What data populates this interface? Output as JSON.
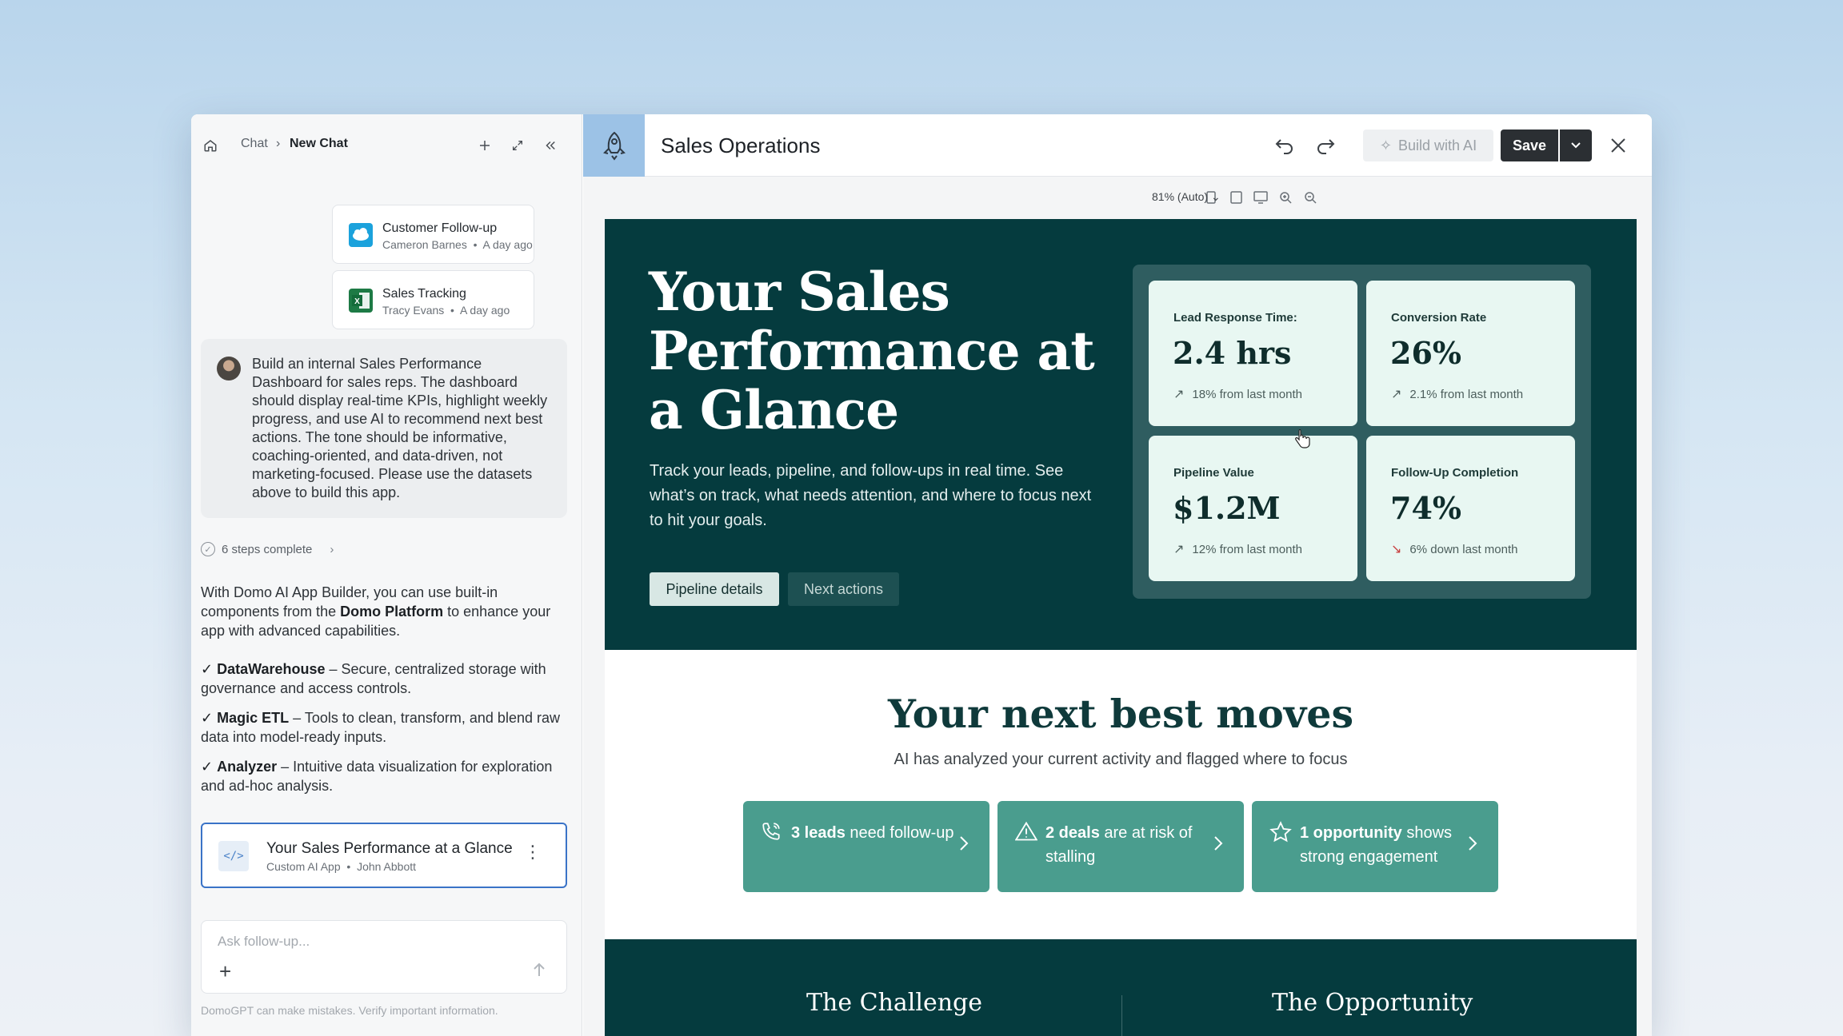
{
  "chat": {
    "breadcrumb": {
      "root": "Chat",
      "separator": "›",
      "current": "New Chat"
    },
    "datasets": [
      {
        "name": "Customer Follow-up",
        "owner": "Cameron Barnes",
        "time": "A day ago",
        "icon": "salesforce-icon",
        "color": "#1ba2dc"
      },
      {
        "name": "Sales Tracking",
        "owner": "Tracy Evans",
        "time": "A day ago",
        "icon": "excel-icon",
        "color": "#1d7a45"
      }
    ],
    "prompt": "Build an internal Sales Performance Dashboard for sales reps. The dashboard should display real-time KPIs, highlight weekly progress, and use AI to recommend next best actions. The tone should be informative, coaching-oriented, and data-driven, not marketing-focused. Please use the datasets above to build this app.",
    "steps_label": "6 steps complete",
    "response": {
      "intro_pre": "With Domo AI App Builder, you can use built-in components from the ",
      "intro_bold": "Domo Platform",
      "intro_post": " to enhance your app with advanced capabilities.",
      "features": [
        {
          "name": "DataWarehouse",
          "desc": " – Secure, centralized storage with governance and access controls."
        },
        {
          "name": "Magic ETL",
          "desc": " – Tools to clean, transform, and blend raw data into model-ready inputs."
        },
        {
          "name": "Analyzer",
          "desc": " – Intuitive data visualization for exploration and ad-hoc analysis."
        }
      ],
      "check": "✓"
    },
    "app_card": {
      "title": "Your Sales Performance at a Glance",
      "type": "Custom AI App",
      "owner": "John Abbott",
      "icon": "</>"
    },
    "input_placeholder": "Ask follow-up...",
    "disclaimer": "DomoGPT can make mistakes. Verify important information."
  },
  "editor": {
    "title": "Sales Operations",
    "build_ai_label": "Build with AI",
    "save_label": "Save",
    "zoom_label": "81% (Auto)",
    "accent": "#9cc2e6"
  },
  "app": {
    "hero": {
      "title": "Your Sales Performance at a Glance",
      "subtitle": "Track your leads, pipeline, and follow-ups in real time. See what’s on track, what needs attention, and where to focus next to hit your goals.",
      "btn_primary": "Pipeline details",
      "btn_secondary": "Next actions",
      "bg": "#053b3e"
    },
    "kpis": [
      {
        "label": "Lead Response Time:",
        "value": "2.4 hrs",
        "delta": "18% from last month",
        "dir": "up"
      },
      {
        "label": "Conversion Rate",
        "value": "26%",
        "delta": "2.1% from last month",
        "dir": "up"
      },
      {
        "label": "Pipeline Value",
        "value": "$1.2M",
        "delta": "12% from last month",
        "dir": "up"
      },
      {
        "label": "Follow-Up Completion",
        "value": "74%",
        "delta": "6% down last month",
        "dir": "down"
      }
    ],
    "moves": {
      "title": "Your next best moves",
      "subtitle": "AI has analyzed your current activity and flagged where to focus",
      "items": [
        {
          "bold": "3 leads",
          "rest": " need follow-up",
          "icon": "phone-icon"
        },
        {
          "bold": "2 deals",
          "rest": " are at risk of stalling",
          "icon": "warning-icon"
        },
        {
          "bold": "1 opportunity",
          "rest": " shows strong engagement",
          "icon": "star-icon"
        }
      ]
    },
    "bottom": {
      "left_heading": "The Challenge",
      "right_heading": "The Opportunity"
    }
  }
}
